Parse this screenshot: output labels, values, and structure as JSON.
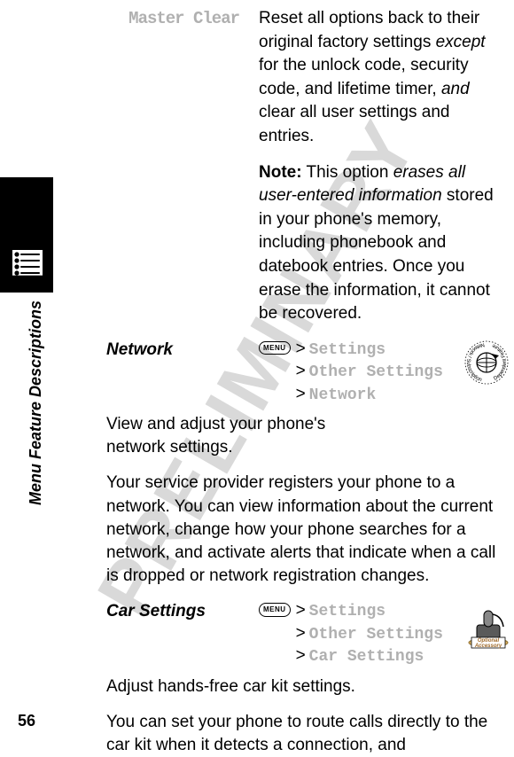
{
  "watermark": "PRELIMINARY",
  "side_label": "Menu Feature Descriptions",
  "page_number": "56",
  "master_clear": {
    "title": "Master Clear",
    "desc_pre": "Reset all options back to their original factory settings ",
    "desc_ital1": "except",
    "desc_mid": " for the unlock code, security code, and lifetime timer, ",
    "desc_ital2": "and",
    "desc_post": " clear all user settings and entries.",
    "note_label": "Note:",
    "note_pre": " This option ",
    "note_ital": "erases all user-entered information",
    "note_post": " stored in your phone's memory, including phonebook and datebook entries. Once you erase the information, it cannot be recovered."
  },
  "network": {
    "title": "Network",
    "menu_label": "MENU",
    "path1": "Settings",
    "path2": "Other Settings",
    "path3": "Network",
    "body1": "View and adjust your phone's network settings.",
    "body2": "Your service provider registers your phone to a network. You can view information about the current network, change how your phone searches for a network, and activate alerts that indicate when a call is dropped or network registration changes."
  },
  "car": {
    "title": "Car Settings",
    "menu_label": "MENU",
    "path1": "Settings",
    "path2": "Other Settings",
    "path3": "Car Settings",
    "body1": "Adjust hands-free car kit settings.",
    "body2": "You can set your phone to route calls directly to the car kit when it detects a connection, and"
  },
  "gt": ">",
  "optional_accessory": "Optional\nAccessory"
}
